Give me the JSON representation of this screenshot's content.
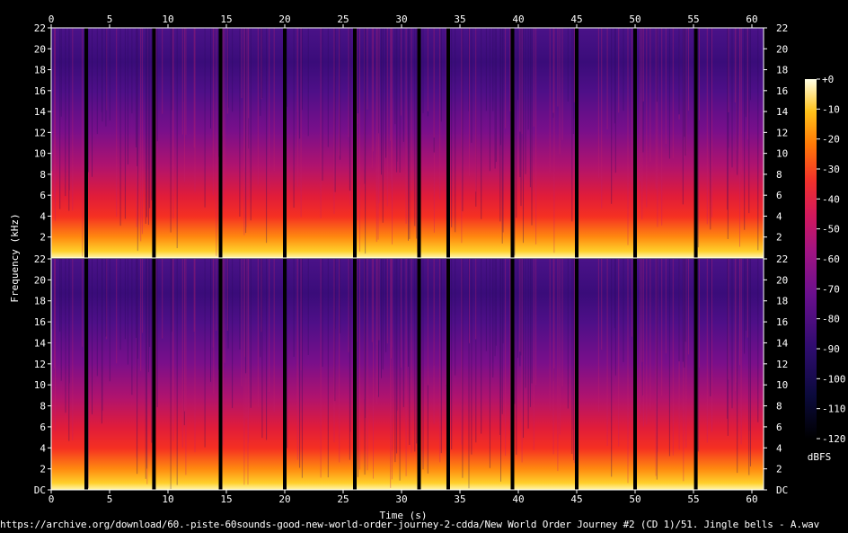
{
  "chart_data": {
    "type": "heatmap",
    "title": "",
    "xlabel": "Time (s)",
    "ylabel": "Frequency (kHz)",
    "x_ticks": [
      "0",
      "5",
      "10",
      "15",
      "20",
      "25",
      "30",
      "35",
      "40",
      "45",
      "50",
      "55",
      "60"
    ],
    "y_ticks": [
      "DC",
      "2",
      "4",
      "6",
      "8",
      "10",
      "12",
      "14",
      "16",
      "18",
      "20",
      "22"
    ],
    "xlim": [
      0,
      61
    ],
    "ylim": [
      0,
      22
    ],
    "channels": 2,
    "silence_gaps_s": [
      3.0,
      8.8,
      14.5,
      20.0,
      26.0,
      31.5,
      34.0,
      39.5,
      45.0,
      50.0,
      55.2
    ],
    "colorbar": {
      "label": "dBFS",
      "ticks": [
        "+0",
        "-10",
        "-20",
        "-30",
        "-40",
        "-50",
        "-60",
        "-70",
        "-80",
        "-90",
        "-100",
        "-110",
        "-120"
      ],
      "range": [
        -120,
        0
      ]
    },
    "caption": "https://archive.org/download/60.-piste-60sounds-good-new-world-order-journey-2-cdda/New World Order Journey #2 (CD 1)/51. Jingle bells - A.wav"
  }
}
